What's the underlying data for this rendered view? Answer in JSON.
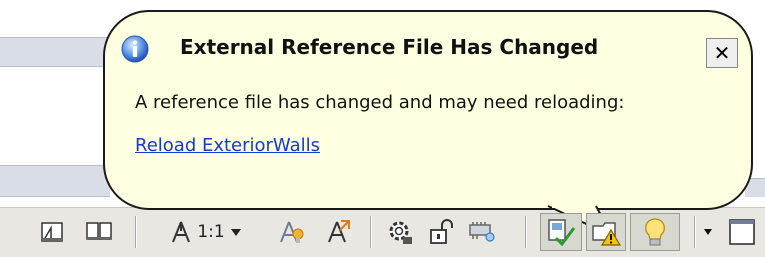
{
  "notification": {
    "title": "External Reference File Has Changed",
    "message": "A reference file has changed and may need reloading:",
    "link_label": "Reload ExteriorWalls",
    "close_glyph": "✕",
    "icon": "info-icon",
    "background_color": "#ffffe1",
    "link_color": "#1538d6"
  },
  "statusbar": {
    "background_color": "#e8e7e1",
    "annotation_scale_label": "1:1",
    "items": [
      "model-space-icon",
      "layout-tabs-icon",
      "annotation-scale-icon",
      "annotation-visibility-icon",
      "auto-scale-icon",
      "workspace-switching-icon",
      "toolbar-lock-icon",
      "hardware-acceleration-icon",
      "xref-status-icon",
      "xref-changed-warning-icon",
      "isolate-objects-icon",
      "statusbar-menu-arrow",
      "clean-screen-icon"
    ]
  }
}
